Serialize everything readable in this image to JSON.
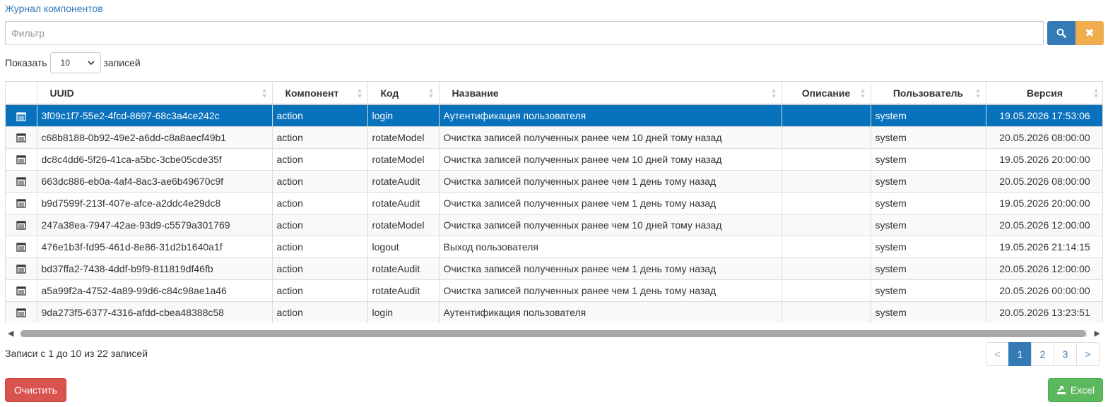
{
  "breadcrumb": "Журнал компонентов",
  "filter": {
    "placeholder": "Фильтр",
    "value": ""
  },
  "length": {
    "show_label": "Показать",
    "selected": "10",
    "records_label": "записей"
  },
  "columns": [
    "",
    "UUID",
    "Компонент",
    "Код",
    "Название",
    "Описание",
    "Пользователь",
    "Версия"
  ],
  "rows": [
    {
      "uuid": "3f09c1f7-55e2-4fcd-8697-68c3a4ce242c",
      "component": "action",
      "code": "login",
      "name": "Аутентификация пользователя",
      "description": "",
      "user": "system",
      "version": "19.05.2026 17:53:06",
      "selected": true
    },
    {
      "uuid": "c68b8188-0b92-49e2-a6dd-c8a8aecf49b1",
      "component": "action",
      "code": "rotateModel",
      "name": "Очистка записей полученных ранее чем 10 дней тому назад",
      "description": "",
      "user": "system",
      "version": "20.05.2026 08:00:00"
    },
    {
      "uuid": "dc8c4dd6-5f26-41ca-a5bc-3cbe05cde35f",
      "component": "action",
      "code": "rotateModel",
      "name": "Очистка записей полученных ранее чем 10 дней тому назад",
      "description": "",
      "user": "system",
      "version": "19.05.2026 20:00:00"
    },
    {
      "uuid": "663dc886-eb0a-4af4-8ac3-ae6b49670c9f",
      "component": "action",
      "code": "rotateAudit",
      "name": "Очистка записей полученных ранее чем 1 день тому назад",
      "description": "",
      "user": "system",
      "version": "20.05.2026 08:00:00"
    },
    {
      "uuid": "b9d7599f-213f-407e-afce-a2ddc4e29dc8",
      "component": "action",
      "code": "rotateAudit",
      "name": "Очистка записей полученных ранее чем 1 день тому назад",
      "description": "",
      "user": "system",
      "version": "19.05.2026 20:00:00"
    },
    {
      "uuid": "247a38ea-7947-42ae-93d9-c5579a301769",
      "component": "action",
      "code": "rotateModel",
      "name": "Очистка записей полученных ранее чем 10 дней тому назад",
      "description": "",
      "user": "system",
      "version": "20.05.2026 12:00:00"
    },
    {
      "uuid": "476e1b3f-fd95-461d-8e86-31d2b1640a1f",
      "component": "action",
      "code": "logout",
      "name": "Выход пользователя",
      "description": "",
      "user": "system",
      "version": "19.05.2026 21:14:15"
    },
    {
      "uuid": "bd37ffa2-7438-4ddf-b9f9-811819df46fb",
      "component": "action",
      "code": "rotateAudit",
      "name": "Очистка записей полученных ранее чем 1 день тому назад",
      "description": "",
      "user": "system",
      "version": "20.05.2026 12:00:00"
    },
    {
      "uuid": "a5a99f2a-4752-4a89-99d6-c84c98ae1a46",
      "component": "action",
      "code": "rotateAudit",
      "name": "Очистка записей полученных ранее чем 1 день тому назад",
      "description": "",
      "user": "system",
      "version": "20.05.2026 00:00:00"
    },
    {
      "uuid": "9da273f5-6377-4316-afdd-cbea48388c58",
      "component": "action",
      "code": "login",
      "name": "Аутентификация пользователя",
      "description": "",
      "user": "system",
      "version": "20.05.2026 13:23:51"
    }
  ],
  "info": "Записи с 1 до 10 из 22 записей",
  "pagination": {
    "prev": "<",
    "pages": [
      "1",
      "2",
      "3"
    ],
    "active": "1",
    "next": ">"
  },
  "buttons": {
    "clear": "Очистить",
    "excel": "Excel"
  },
  "colors": {
    "primary": "#337ab7",
    "selected_row": "#0872bc",
    "warning": "#f0ad4e",
    "danger": "#d9534f",
    "success": "#5cb85c"
  },
  "icons": {
    "search": "search-icon",
    "clear_filter": "close-icon",
    "row": "document-icon",
    "excel": "export-icon"
  }
}
